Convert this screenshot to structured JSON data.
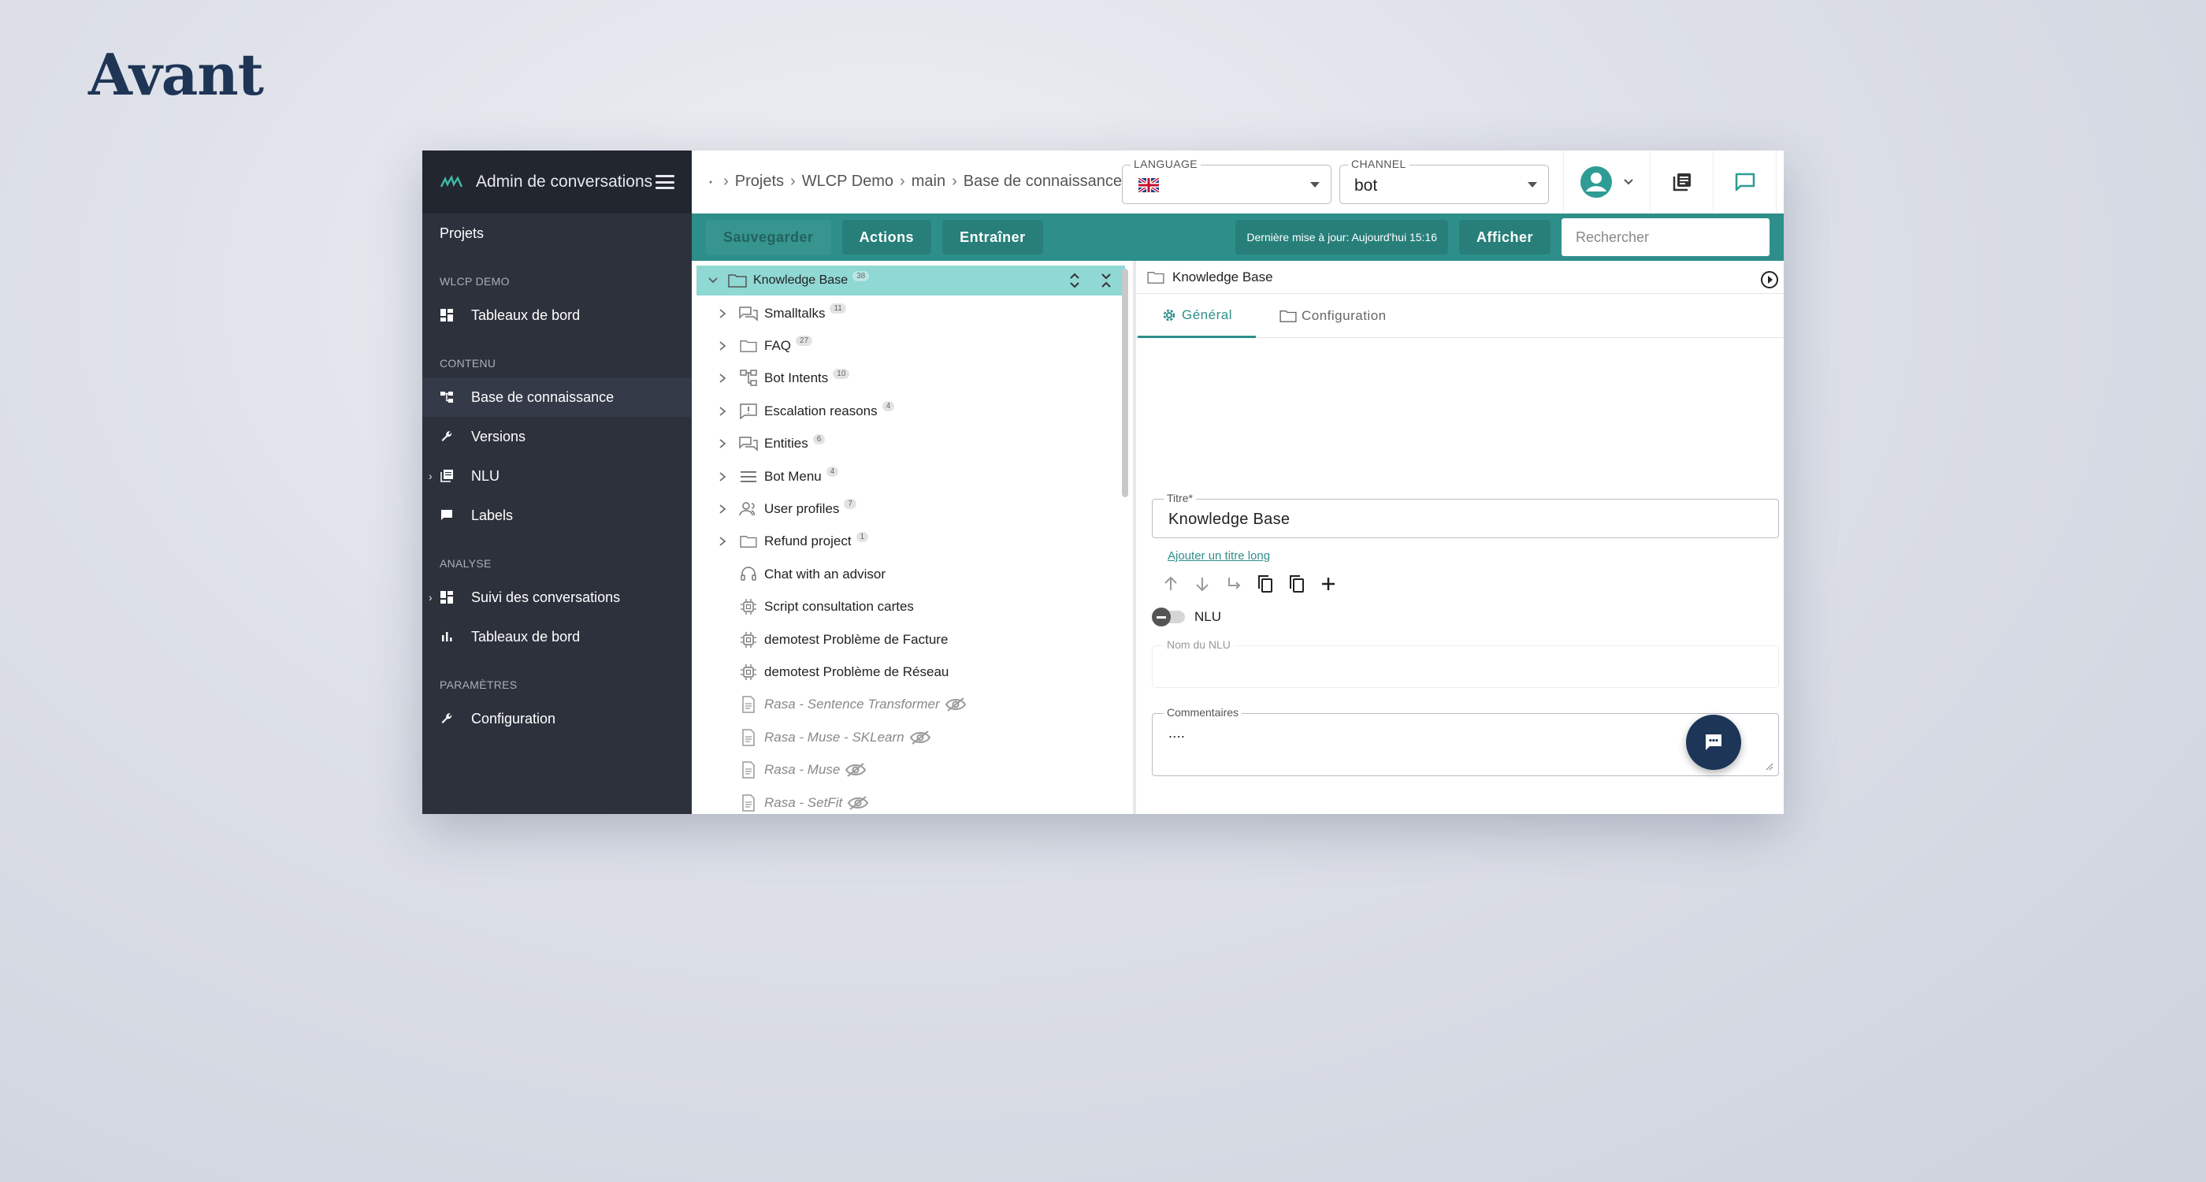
{
  "page_title": "Avant",
  "sidebar": {
    "app_title": "Admin de conversations",
    "projects": "Projets",
    "sections": [
      {
        "title": "WLCP DEMO",
        "items": [
          {
            "label": "Tableaux de bord",
            "icon": "dashboard-icon"
          }
        ]
      },
      {
        "title": "CONTENU",
        "items": [
          {
            "label": "Base de connaissance",
            "icon": "tree-icon",
            "active": true
          },
          {
            "label": "Versions",
            "icon": "wrench-icon"
          },
          {
            "label": "NLU",
            "icon": "library-icon",
            "expandable": true
          },
          {
            "label": "Labels",
            "icon": "comment-icon"
          }
        ]
      },
      {
        "title": "ANALYSE",
        "items": [
          {
            "label": "Suivi des conversations",
            "icon": "dashboard-icon",
            "expandable": true
          },
          {
            "label": "Tableaux de bord",
            "icon": "bar-chart-icon"
          }
        ]
      },
      {
        "title": "PARAMÈTRES",
        "items": [
          {
            "label": "Configuration",
            "icon": "wrench-icon"
          }
        ]
      }
    ]
  },
  "breadcrumb": [
    "Projets",
    "WLCP Demo",
    "main",
    "Base de connaissance"
  ],
  "language": {
    "label": "LANGUAGE",
    "value_icon": "uk-flag-icon"
  },
  "channel": {
    "label": "CHANNEL",
    "value": "bot"
  },
  "toolbar": {
    "save": "Sauvegarder",
    "actions": "Actions",
    "train": "Entraîner",
    "last_update": "Dernière mise à jour: Aujourd'hui 15:16",
    "show": "Afficher",
    "search_placeholder": "Rechercher"
  },
  "tree": {
    "root": {
      "label": "Knowledge Base",
      "count": "38"
    },
    "items": [
      {
        "label": "Smalltalks",
        "count": "11",
        "icon": "chat-folder-icon",
        "expandable": true
      },
      {
        "label": "FAQ",
        "count": "27",
        "icon": "folder-icon",
        "expandable": true
      },
      {
        "label": "Bot Intents",
        "count": "10",
        "icon": "hierarchy-icon",
        "expandable": true
      },
      {
        "label": "Escalation reasons",
        "count": "4",
        "icon": "alert-icon",
        "expandable": true
      },
      {
        "label": "Entities",
        "count": "6",
        "icon": "chat-folder-icon",
        "expandable": true
      },
      {
        "label": "Bot Menu",
        "count": "4",
        "icon": "menu-icon",
        "expandable": true
      },
      {
        "label": "User profiles",
        "count": "7",
        "icon": "users-icon",
        "expandable": true
      },
      {
        "label": "Refund project",
        "count": "1",
        "icon": "folder-icon",
        "expandable": true
      },
      {
        "label": "Chat with an advisor",
        "icon": "headset-icon"
      },
      {
        "label": "Script consultation cartes",
        "icon": "chip-icon"
      },
      {
        "label": "demotest Problème de Facture",
        "icon": "chip-icon"
      },
      {
        "label": "demotest Problème de Réseau",
        "icon": "chip-icon"
      },
      {
        "label": "Rasa - Sentence Transformer",
        "icon": "document-icon",
        "hidden": true
      },
      {
        "label": "Rasa - Muse - SKLearn",
        "icon": "document-icon",
        "hidden": true
      },
      {
        "label": "Rasa - Muse",
        "icon": "document-icon",
        "hidden": true
      },
      {
        "label": "Rasa - SetFit",
        "icon": "document-icon",
        "hidden": true
      }
    ]
  },
  "detail": {
    "title": "Knowledge Base",
    "tabs": [
      "Général",
      "Configuration"
    ],
    "title_field": {
      "label": "Titre*",
      "value": "Knowledge Base"
    },
    "long_title_link": "Ajouter un titre long",
    "nlu_toggle": "NLU",
    "nlu_name_label": "Nom du NLU",
    "comments_label": "Commentaires",
    "comments_value": "...."
  },
  "colors": {
    "accent": "#2e8f8a",
    "sidebar": "#2c313c",
    "tree_selected": "#8fd8d4",
    "fab": "#1d3557"
  }
}
